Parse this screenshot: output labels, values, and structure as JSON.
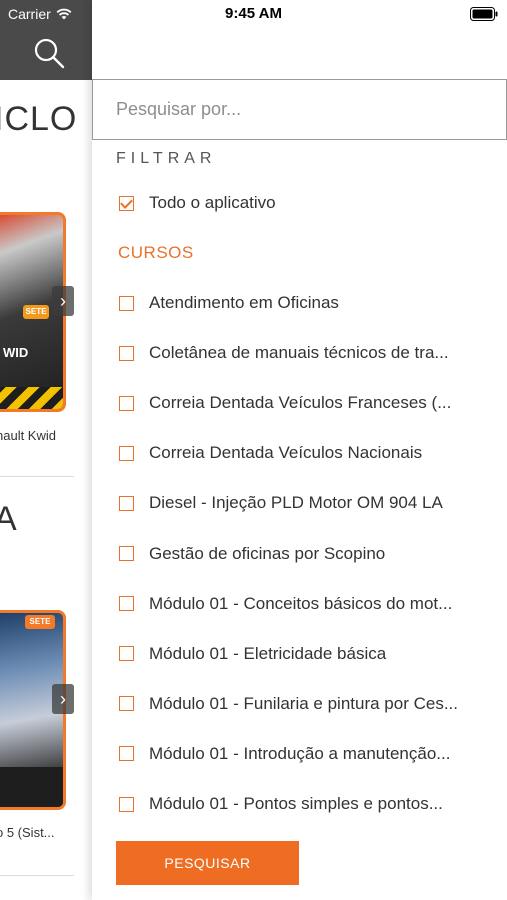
{
  "status_bar": {
    "carrier": "Carrier",
    "time": "9:45 AM"
  },
  "background": {
    "title_1": "ICLO",
    "title_2": "A",
    "card_1_badge": "SETE",
    "card_1_text": "WID",
    "card_2_badge": "SETE",
    "caption_1": "nault Kwid",
    "caption_2": "o 5 (Sist..."
  },
  "search": {
    "placeholder": "Pesquisar por...",
    "value": ""
  },
  "filter": {
    "heading": "FILTRAR",
    "all_app_label": "Todo o aplicativo",
    "all_app_checked": true,
    "section_heading": "CURSOS",
    "courses": [
      "Atendimento em Oficinas",
      "Coletânea de manuais técnicos de tra...",
      "Correia Dentada Veículos Franceses (...",
      "Correia Dentada Veículos Nacionais",
      "Diesel - Injeção PLD Motor OM 904 LA",
      "Gestão de oficinas por Scopino",
      "Módulo 01 - Conceitos básicos do mot...",
      "Módulo 01 - Eletricidade básica",
      "Módulo 01 - Funilaria e pintura por Ces...",
      "Módulo 01 - Introdução a manutenção...",
      "Módulo 01 - Pontos simples e pontos..."
    ]
  },
  "actions": {
    "search_button": "PESQUISAR"
  },
  "colors": {
    "accent": "#ef6d22",
    "header_bg": "#4a4a4a"
  }
}
